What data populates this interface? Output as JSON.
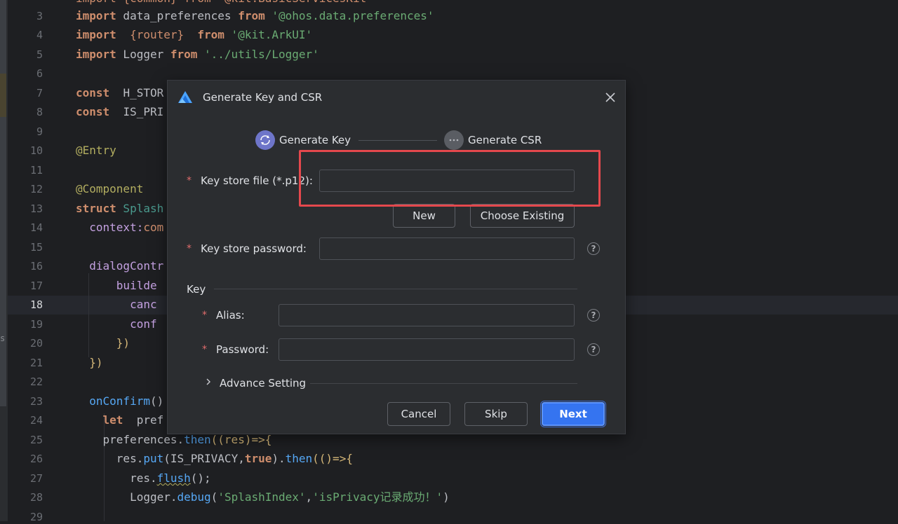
{
  "editor": {
    "line_numbers": [
      "3",
      "4",
      "5",
      "6",
      "7",
      "8",
      "9",
      "10",
      "11",
      "12",
      "13",
      "14",
      "15",
      "16",
      "17",
      "18",
      "19",
      "20",
      "21",
      "22",
      "23",
      "24",
      "25",
      "26",
      "27",
      "28",
      "29"
    ],
    "current_line": "18",
    "partial_top_text": "import {common} from '@kit.BasicServicesKit'",
    "lines": {
      "l3_a": "import",
      "l3_b": " data_preferences ",
      "l3_c": "from",
      "l3_d": " '@ohos.data.preferences'",
      "l4_a": "import",
      "l4_b": "  {router}  ",
      "l4_c": "from",
      "l4_d": " '@kit.ArkUI'",
      "l5_a": "import",
      "l5_b": " Logger ",
      "l5_c": "from",
      "l5_d": " '../utils/Logger'",
      "l7_a": "const",
      "l7_b": "  H_STOR",
      "l8_a": "const",
      "l8_b": "  IS_PRI",
      "l10": "@Entry",
      "l12": "@Component",
      "l13_a": "struct",
      "l13_b": " Splash",
      "l14_a": "  context:",
      "l14_b": "com",
      "l16": "  dialogContr",
      "l17": "      builde",
      "l18": "        canc",
      "l19": "        conf",
      "l20": "      })",
      "l21": "  })",
      "l23_a": "  onConfirm",
      "l23_b": "()",
      "l24_a": "    let",
      "l24_b": "  pref",
      "l25_a": "    preferences.",
      "l25_b": "then",
      "l25_c": "((res)=>{",
      "l26_a": "      res.",
      "l26_b": "put",
      "l26_c": "(IS_PRIVACY,",
      "l26_d": "true",
      "l26_e": ").",
      "l26_f": "then",
      "l26_g": "(()=>{",
      "l27_a": "        res.",
      "l27_b": "flush",
      "l27_c": "();",
      "l28_a": "        Logger.",
      "l28_b": "debug",
      "l28_c": "(",
      "l28_d": "'SplashIndex'",
      "l28_e": ",",
      "l28_f": "'isPrivacy记录成功！'",
      "l28_g": ")"
    },
    "left_strip_char": "s"
  },
  "dialog": {
    "title": "Generate Key and CSR",
    "steps": [
      {
        "label": "Generate Key",
        "state": "active"
      },
      {
        "label": "Generate CSR",
        "state": "pending"
      }
    ],
    "key_store_file": {
      "label": "Key store file (*.p12):",
      "value": "",
      "required_mark": "*"
    },
    "new_button": "New",
    "choose_existing_button": "Choose Existing",
    "key_store_password": {
      "label": "Key store password:",
      "value": "",
      "required_mark": "*"
    },
    "key_section": "Key",
    "alias": {
      "label": "Alias:",
      "value": "",
      "required_mark": "*"
    },
    "password": {
      "label": "Password:",
      "value": "",
      "required_mark": "*"
    },
    "advance_setting": "Advance Setting",
    "help_glyph": "?",
    "buttons": {
      "cancel": "Cancel",
      "skip": "Skip",
      "next": "Next"
    }
  },
  "colors": {
    "accent": "#3574f0",
    "step_active": "#6e75c9",
    "highlight_annotation": "#e5484d"
  }
}
